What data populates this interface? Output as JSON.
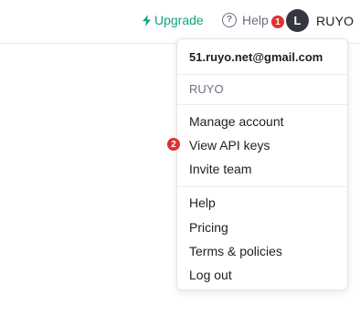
{
  "header": {
    "upgrade_label": "Upgrade",
    "help_label": "Help",
    "help_glyph": "?",
    "avatar_initial": "L",
    "username": "RUYO"
  },
  "annotations": {
    "badge_1": "1",
    "badge_2": "2"
  },
  "menu": {
    "email": "51.ruyo.net@gmail.com",
    "org": "RUYO",
    "account_items": [
      "Manage account",
      "View API keys",
      "Invite team"
    ],
    "footer_items": [
      "Help",
      "Pricing",
      "Terms & policies",
      "Log out"
    ]
  },
  "colors": {
    "accent": "#10a37f",
    "badge": "#e03131",
    "avatar_bg": "#353740"
  },
  "icons": {
    "upgrade": "lightning-bolt-icon",
    "help": "question-circle-icon"
  }
}
